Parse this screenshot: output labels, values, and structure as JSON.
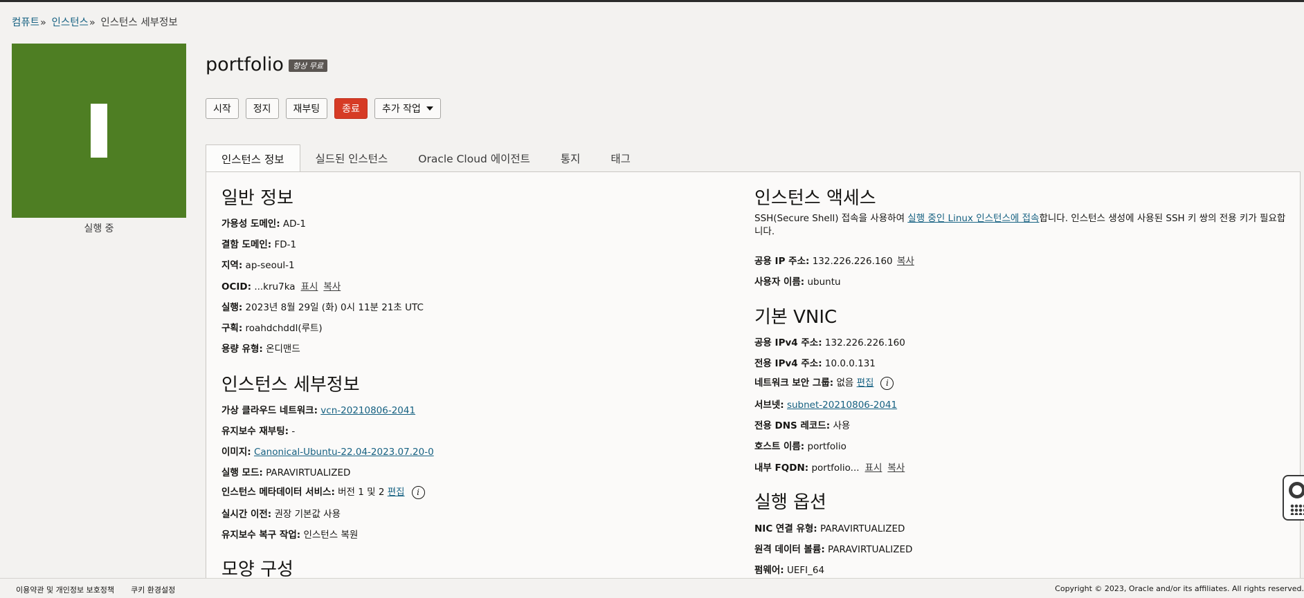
{
  "breadcrumb": {
    "items": [
      "컴퓨트",
      "인스턴스",
      "인스턴스 세부정보"
    ],
    "sep": "»"
  },
  "tile": {
    "status": "실행 중"
  },
  "header": {
    "title": "portfolio",
    "badge": "항상 무료"
  },
  "actions": {
    "start": "시작",
    "stop": "정지",
    "reboot": "재부팅",
    "terminate": "종료",
    "more": "추가 작업"
  },
  "tabs": [
    "인스턴스 정보",
    "실드된 인스턴스",
    "Oracle Cloud 에이전트",
    "통지",
    "태그"
  ],
  "general": {
    "heading": "일반 정보",
    "ad_label": "가용성 도메인:",
    "ad_value": "AD-1",
    "fd_label": "결함 도메인:",
    "fd_value": "FD-1",
    "region_label": "지역:",
    "region_value": "ap-seoul-1",
    "ocid_label": "OCID:",
    "ocid_value": "...kru7ka",
    "show": "표시",
    "copy": "복사",
    "launched_label": "실행:",
    "launched_value": "2023년 8월 29일 (화) 0시 11분 21초 UTC",
    "compartment_label": "구획:",
    "compartment_value": "roahdchddl(루트)",
    "capacity_label": "용량 유형:",
    "capacity_value": "온디맨드"
  },
  "details": {
    "heading": "인스턴스 세부정보",
    "vcn_label": "가상 클라우드 네트워크:",
    "vcn_value": "vcn-20210806-2041",
    "maint_label": "유지보수 재부팅:",
    "maint_value": "-",
    "image_label": "이미지:",
    "image_value": "Canonical-Ubuntu-22.04-2023.07.20-0",
    "mode_label": "실행 모드:",
    "mode_value": "PARAVIRTUALIZED",
    "imds_label": "인스턴스 메타데이터 서비스:",
    "imds_value": "버전 1 및 2",
    "edit": "편집",
    "live_label": "실시간 이전:",
    "live_value": "권장 기본값 사용",
    "recovery_label": "유지보수 복구 작업:",
    "recovery_value": "인스턴스 복원"
  },
  "shape": {
    "heading": "모양 구성"
  },
  "access": {
    "heading": "인스턴스 액세스",
    "desc_before": "SSH(Secure Shell) 접속을 사용하여 ",
    "desc_link": "실행 중인 Linux 인스턴스에 접속",
    "desc_after": "합니다. 인스턴스 생성에 사용된 SSH 키 쌍의 전용 키가 필요합니다.",
    "ip_label": "공용 IP 주소:",
    "ip_value": "132.226.226.160",
    "copy": "복사",
    "user_label": "사용자 이름:",
    "user_value": "ubuntu"
  },
  "vnic": {
    "heading": "기본 VNIC",
    "pub_label": "공용 IPv4 주소:",
    "pub_value": "132.226.226.160",
    "priv_label": "전용 IPv4 주소:",
    "priv_value": "10.0.0.131",
    "nsg_label": "네트워크 보안 그룹:",
    "nsg_value": "없음",
    "edit": "편집",
    "subnet_label": "서브넷:",
    "subnet_value": "subnet-20210806-2041",
    "dns_label": "전용 DNS 레코드:",
    "dns_value": "사용",
    "host_label": "호스트 이름:",
    "host_value": "portfolio",
    "fqdn_label": "내부 FQDN:",
    "fqdn_value": "portfolio...",
    "show": "표시",
    "copy": "복사"
  },
  "launch": {
    "heading": "실행 옵션",
    "nic_label": "NIC 연결 유형:",
    "nic_value": "PARAVIRTUALIZED",
    "rv_label": "원격 데이터 볼륨:",
    "rv_value": "PARAVIRTUALIZED",
    "fw_label": "펌웨어:",
    "fw_value": "UEFI_64"
  },
  "info_glyph": "i",
  "footer": {
    "terms": "이용약관 및 개인정보 보호정책",
    "cookies": "쿠키 환경설정",
    "copyright": "Copyright © 2023, Oracle and/or its affiliates. All rights reserved."
  }
}
